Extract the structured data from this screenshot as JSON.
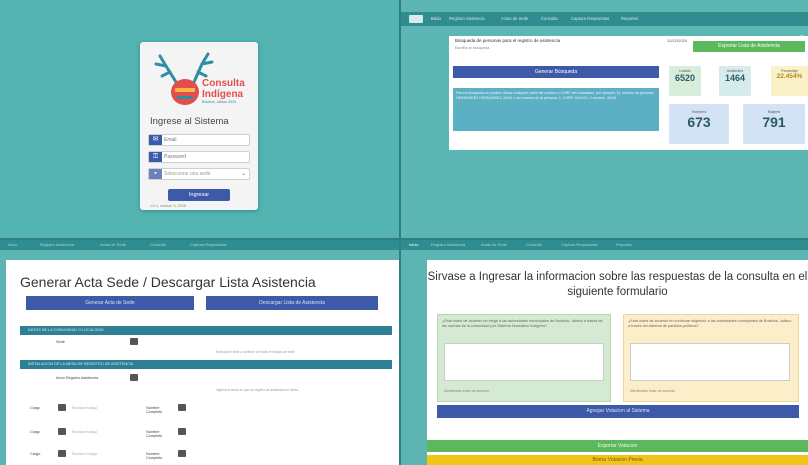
{
  "login": {
    "logo_line1": "Consulta",
    "logo_line2": "Indígena",
    "logo_line3": "Bolaños, Jalisco 2025",
    "title": "Ingrese al Sistema",
    "email_placeholder": "Email",
    "password_placeholder": "Password",
    "sede_placeholder": "Seleccione una sede",
    "button": "Ingresar",
    "version": "v.0.1, version 3, 2025"
  },
  "dashboard": {
    "nav_items": [
      "Inicio",
      "Registro Asistencia",
      "Actas de Sede",
      "Consulta",
      "Captura Respuestas",
      "Reportes"
    ],
    "search_title": "Búsqueda de personas para el registro de asistencia",
    "date": "12/12/2024",
    "search_hint": "Escriba la búsqueda",
    "export_button": "Exportar Lista de Asistencia",
    "search_button": "Generar Búsqueda",
    "info_text": "Para el búsqueda es posible utilizar cualquier parte del nombre o CURP del ciudadano, por ejemplo: Ej. nombre de persona: HERNANDEZ HERNANDEZ JUAN o del nombre de la persona: 1. CURP: MXXXX, 2 nombre: JUAN",
    "stats": [
      {
        "label": "Listado",
        "value": "6520"
      },
      {
        "label": "Asistentes",
        "value": "1464"
      },
      {
        "label": "Porcentaje",
        "value": "22.454%"
      },
      {
        "label": "Hombres",
        "value": "673"
      },
      {
        "label": "Mujeres",
        "value": "791"
      }
    ]
  },
  "acta": {
    "title": "Generar Acta Sede / Descargar Lista Asistencia",
    "button_generate": "Generar Acta de Sede",
    "button_download": "Descargar Lista de Asistencia",
    "section1": "DATOS DE LA COMUNIDAD O LOCALIDAD",
    "sede_label": "Sede",
    "sede_hint": "Seleccione sede y continúe con todo el modulo de sede",
    "section2": "INSTALACION DE LA MESA DE REGISTRO DE ASISTENCIA",
    "registro_label": "Inicio Registro Asistencia",
    "registro_hint": "Ingrese la fecha en que se registro de asistencia en forma",
    "cargo_label": "Cargo",
    "cargo_placeholder": "Escriba el cargo",
    "nombre_label": "Nombre Completo"
  },
  "form": {
    "title": "Sirvase a Ingresar la informacion sobre las respuestas de la consulta en el siguiente formulario",
    "q1": "¿Está usted de acuerdo en elegir a las autoridades municipales de Bolaños, Jalisco a través de las normas de la comunidad por Sistema Normativo Indígena?",
    "q2": "¿Está usted de acuerdo en continuar eligiendo a las autoridades municipales de Bolaños, Jalisco a través del sistema de partidos políticos?",
    "q1_footer": "Manifiestan estar de acuerdo",
    "q2_footer": "Manifiestan estar de acuerdo",
    "button_save": "Agregar Votacion al Sistema",
    "button_export": "Exportar Votacion",
    "button_delete": "Borrar Votacion Previa"
  },
  "colors": {
    "teal_bg": "#53b4b2",
    "nav_teal": "#2f8d90",
    "primary_blue": "#3d5aa8",
    "success_green": "#5cb85c",
    "warning_yellow": "#f0c419"
  }
}
